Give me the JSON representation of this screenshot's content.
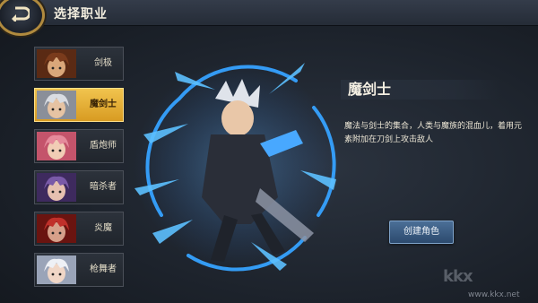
{
  "header": {
    "title": "选择职业",
    "back_icon": "back-arrow-icon"
  },
  "classes": [
    {
      "label": "剑极",
      "selected": false,
      "hair": "#7a3b1c",
      "skin": "#d9a77a",
      "accent": "#5a2a14"
    },
    {
      "label": "魔剑士",
      "selected": true,
      "hair": "#d9dce2",
      "skin": "#e6c3a3",
      "accent": "#8a8f99"
    },
    {
      "label": "盾炮师",
      "selected": false,
      "hair": "#e58a9b",
      "skin": "#f1cdb5",
      "accent": "#c4546b"
    },
    {
      "label": "暗杀者",
      "selected": false,
      "hair": "#7a5aa8",
      "skin": "#e6c0b0",
      "accent": "#3e2a5e"
    },
    {
      "label": "炎魔",
      "selected": false,
      "hair": "#c0302a",
      "skin": "#d6a08a",
      "accent": "#6a1410"
    },
    {
      "label": "枪舞者",
      "selected": false,
      "hair": "#eef0f5",
      "skin": "#f0d6c6",
      "accent": "#9aa4b8"
    }
  ],
  "detail": {
    "name": "魔剑士",
    "description": "魔法与剑士的集合，人类与魔族的混血儿，着用元素附加在刀剑上攻击敌人",
    "create_label": "创建角色"
  },
  "watermark": {
    "logo": "kkx",
    "url": "www.kkx.net"
  },
  "colors": {
    "accent_gold": "#e8b43a",
    "aura_blue": "#2f8fff"
  }
}
